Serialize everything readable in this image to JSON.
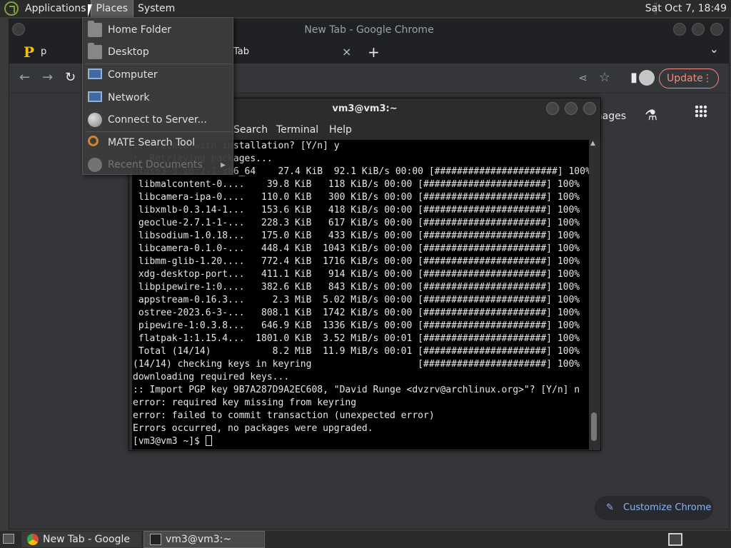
{
  "top_panel": {
    "menus": [
      "Applications",
      "Places",
      "System"
    ],
    "clock": "Sat Oct  7, 18:49"
  },
  "chrome": {
    "window_title": "New Tab - Google Chrome",
    "tab1_label": "p",
    "tab2_label": "Tab",
    "tab_close": "×",
    "new_tab": "+",
    "tab_list": "⌄",
    "update_label": "Update",
    "images_link": "Images",
    "customize_label": "Customize Chrome"
  },
  "terminal": {
    "title": "vm3@vm3:~",
    "menus": [
      "Search",
      "Terminal",
      "Help"
    ],
    "lines": [
      ":: Proceed with installation? [Y/n] y",
      ":: Retrieving packages...",
      " fuse3-3.16.2-1-x86_64    27.4 KiB  92.1 KiB/s 00:00 [######################] 100%",
      " libmalcontent-0....    39.8 KiB   118 KiB/s 00:00 [######################] 100%",
      " libcamera-ipa-0....   110.0 KiB   300 KiB/s 00:00 [######################] 100%",
      " libxmlb-0.3.14-1...   153.6 KiB   418 KiB/s 00:00 [######################] 100%",
      " geoclue-2.7.1-1-...   228.3 KiB   617 KiB/s 00:00 [######################] 100%",
      " libsodium-1.0.18...   175.0 KiB   433 KiB/s 00:00 [######################] 100%",
      " libcamera-0.1.0-...   448.4 KiB  1043 KiB/s 00:00 [######################] 100%",
      " libmm-glib-1.20....   772.4 KiB  1716 KiB/s 00:00 [######################] 100%",
      " xdg-desktop-port...   411.1 KiB   914 KiB/s 00:00 [######################] 100%",
      " libpipewire-1:0....   382.6 KiB   843 KiB/s 00:00 [######################] 100%",
      " appstream-0.16.3...     2.3 MiB  5.02 MiB/s 00:00 [######################] 100%",
      " ostree-2023.6-3-...   808.1 KiB  1742 KiB/s 00:00 [######################] 100%",
      " pipewire-1:0.3.8...   646.9 KiB  1336 KiB/s 00:00 [######################] 100%",
      " flatpak-1:1.15.4...  1801.0 KiB  3.52 MiB/s 00:01 [######################] 100%",
      " Total (14/14)           8.2 MiB  11.9 MiB/s 00:01 [######################] 100%",
      "(14/14) checking keys in keyring                   [######################] 100%",
      "downloading required keys...",
      ":: Import PGP key 9B7A287D9A2EC608, \"David Runge <dvzrv@archlinux.org>\"? [Y/n] n",
      "error: required key missing from keyring",
      "error: failed to commit transaction (unexpected error)",
      "Errors occurred, no packages were upgraded."
    ],
    "prompt": "[vm3@vm3 ~]$ "
  },
  "places_menu": {
    "items": [
      {
        "label": "Home Folder",
        "icon": "home-folder-icon"
      },
      {
        "label": "Desktop",
        "icon": "desktop-folder-icon"
      },
      {
        "label": "Computer",
        "icon": "computer-icon"
      },
      {
        "label": "Network",
        "icon": "network-icon"
      },
      {
        "label": "Connect to Server...",
        "icon": "connect-server-icon"
      },
      {
        "label": "MATE Search Tool",
        "icon": "search-tool-icon"
      },
      {
        "label": "Recent Documents",
        "icon": "recent-documents-icon"
      }
    ],
    "submenu_arrow": "▸"
  },
  "bottom_panel": {
    "tasks": [
      "New Tab - Google ...",
      "vm3@vm3:~"
    ]
  },
  "colors": {
    "panel_bg": "#2b2b2b",
    "chrome_bg": "#35363a",
    "update_accent": "#f28b82",
    "link_accent": "#8ab4f8"
  }
}
